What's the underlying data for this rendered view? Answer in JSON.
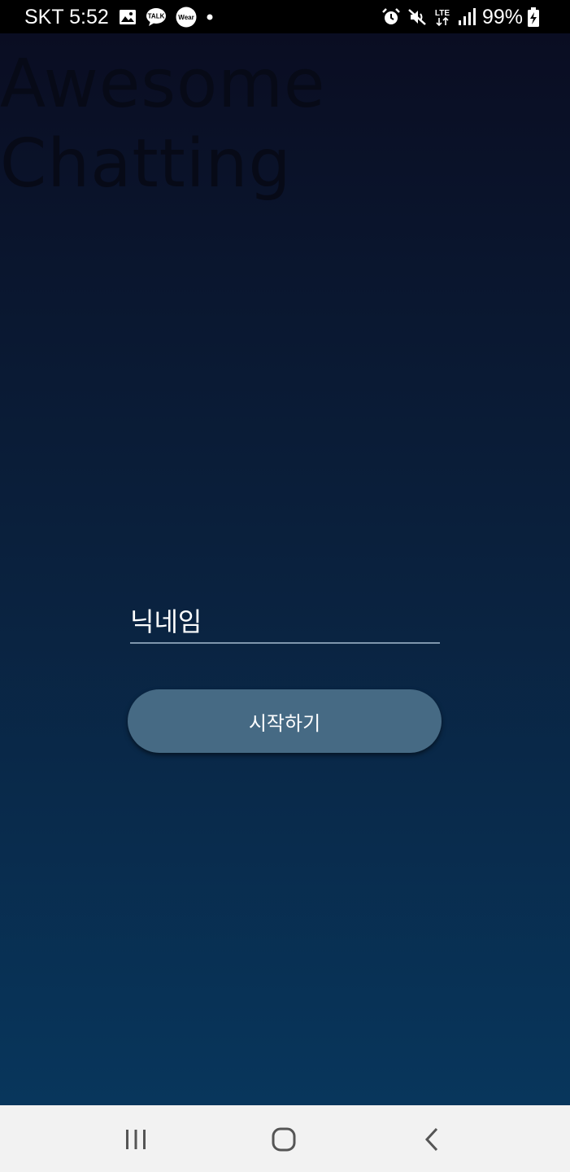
{
  "status_bar": {
    "carrier": "SKT",
    "time": "5:52",
    "left_icons": [
      "gallery-icon",
      "kakaotalk-icon",
      "wear-icon",
      "dot-icon"
    ],
    "talk_icon_text": "TALK",
    "wear_icon_text": "Wear",
    "right_icons": [
      "alarm-icon",
      "mute-icon",
      "lte-icon",
      "signal-icon",
      "battery-charging-icon"
    ],
    "lte_text": "LTE",
    "battery_percent": "99%"
  },
  "app": {
    "title_line1": "Awesome",
    "title_line2": "Chatting",
    "nickname_placeholder": "닉네임",
    "nickname_value": "",
    "start_button_label": "시작하기"
  },
  "nav_bar": {
    "buttons": [
      "recent-apps",
      "home",
      "back"
    ]
  },
  "colors": {
    "background_top": "#0a0d22",
    "background_bottom": "#08365c",
    "button": "#466a84",
    "underline": "#7f96ad",
    "nav_bar": "#f2f2f2"
  }
}
